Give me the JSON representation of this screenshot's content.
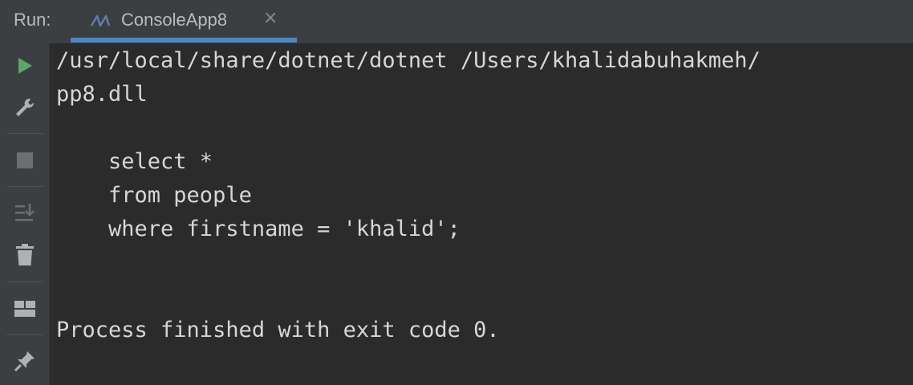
{
  "header": {
    "run_label": "Run:",
    "tab_title": "ConsoleApp8",
    "tab_close": "×",
    "tab_icon": "dotnet-icon",
    "accent_color": "#4a88c7"
  },
  "toolbar": {
    "buttons": [
      {
        "name": "rerun-button",
        "icon": "run-icon",
        "color": "#59a869"
      },
      {
        "name": "settings-button",
        "icon": "wrench-icon"
      },
      {
        "name": "stop-button",
        "icon": "stop-icon"
      },
      {
        "name": "scroll-to-end-button",
        "icon": "scroll-to-end-icon"
      },
      {
        "name": "clear-all-button",
        "icon": "trash-icon"
      },
      {
        "name": "layout-button",
        "icon": "layout-icon"
      },
      {
        "name": "pin-button",
        "icon": "pin-icon"
      }
    ]
  },
  "console": {
    "lines": [
      "/usr/local/share/dotnet/dotnet /Users/khalidabuhakmeh/",
      "pp8.dll",
      "",
      "    select *",
      "    from people",
      "    where firstname = 'khalid';",
      "",
      "",
      "Process finished with exit code 0."
    ]
  }
}
